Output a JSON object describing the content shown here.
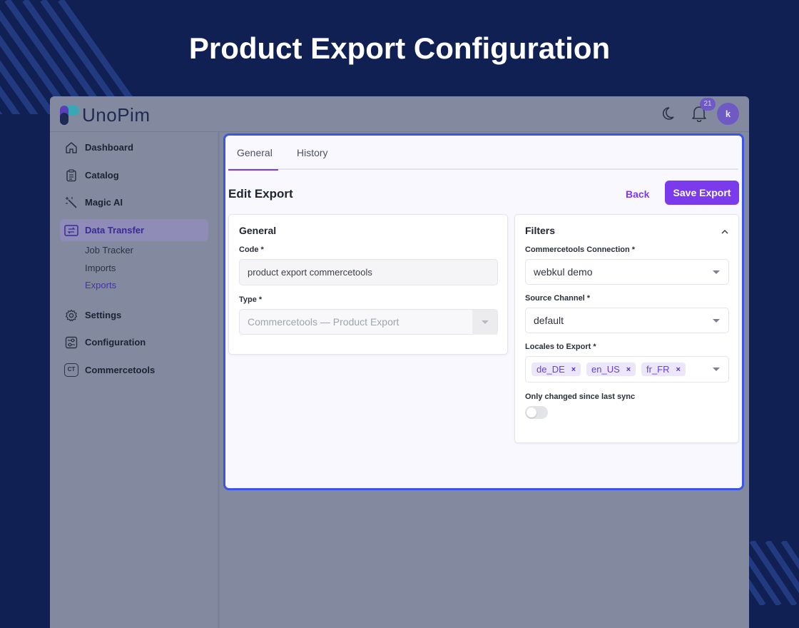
{
  "page": {
    "heading": "Product Export Configuration"
  },
  "app": {
    "logo_text": "UnoPim",
    "notification_count": "21",
    "avatar_initial": "k",
    "brand_color": "#7c3aed"
  },
  "sidebar": {
    "items": [
      {
        "label": "Dashboard",
        "icon": "home-icon"
      },
      {
        "label": "Catalog",
        "icon": "clipboard-icon"
      },
      {
        "label": "Magic AI",
        "icon": "magic-wand-icon"
      },
      {
        "label": "Data Transfer",
        "icon": "data-transfer-icon",
        "active": true
      },
      {
        "label": "Settings",
        "icon": "gear-icon"
      },
      {
        "label": "Configuration",
        "icon": "sliders-icon"
      },
      {
        "label": "Commercetools",
        "icon": "ct-icon",
        "icon_text": "CT"
      }
    ],
    "sub_items": [
      {
        "label": "Job Tracker"
      },
      {
        "label": "Imports"
      },
      {
        "label": "Exports",
        "active": true
      }
    ]
  },
  "tabs": [
    {
      "label": "General",
      "active": true
    },
    {
      "label": "History"
    }
  ],
  "edit": {
    "title": "Edit Export",
    "back_label": "Back",
    "save_label": "Save Export"
  },
  "general_panel": {
    "title": "General",
    "code_label": "Code *",
    "code_value": "product export commercetools",
    "type_label": "Type *",
    "type_value": "Commercetools — Product Export"
  },
  "filters_panel": {
    "title": "Filters",
    "connection_label": "Commercetools Connection *",
    "connection_value": "webkul demo",
    "channel_label": "Source Channel *",
    "channel_value": "default",
    "locales_label": "Locales to Export *",
    "locales": [
      "de_DE",
      "en_US",
      "fr_FR"
    ],
    "remove_glyph": "×",
    "only_changed_label": "Only changed since last sync",
    "only_changed_enabled": false
  }
}
